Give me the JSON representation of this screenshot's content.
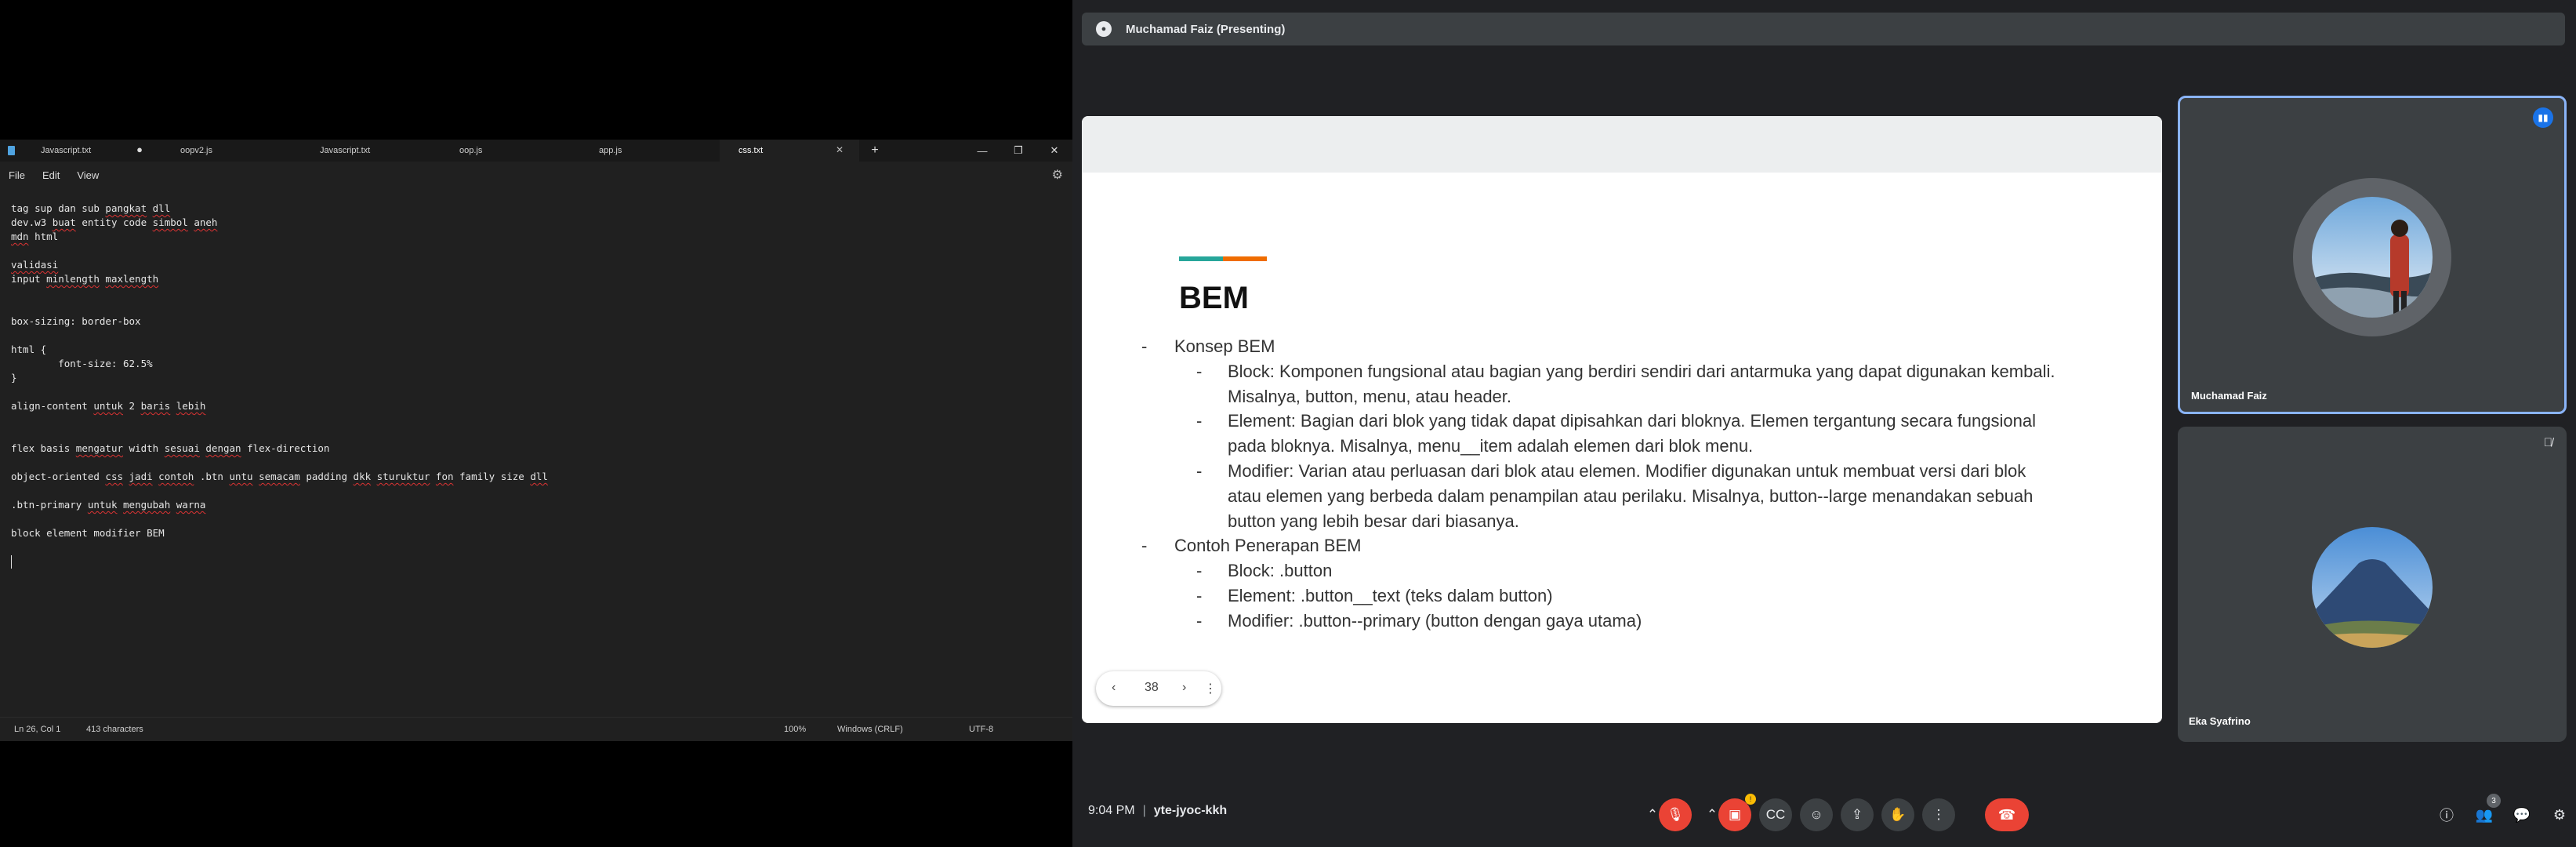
{
  "notepad": {
    "tabs": [
      {
        "label": "Javascript.txt"
      },
      {
        "label": "oopv2.js"
      },
      {
        "label": "Javascript.txt"
      },
      {
        "label": "oop.js"
      },
      {
        "label": "app.js"
      },
      {
        "label": "css.txt"
      }
    ],
    "menu": {
      "file": "File",
      "edit": "Edit",
      "view": "View"
    },
    "lines": {
      "l1a": "tag sup dan sub ",
      "l1b": "pangkat",
      "l1c": " ",
      "l1d": "dll",
      "l2a": "dev.w3 ",
      "l2b": "buat",
      "l2c": " entity code ",
      "l2d": "simbol",
      "l2e": " ",
      "l2f": "aneh",
      "l3a": "mdn",
      "l3b": " html",
      "l5a": "validasi",
      "l6a": "input ",
      "l6b": "minlength",
      "l6c": " ",
      "l6d": "maxlength",
      "l9": "box-sizing: border-box",
      "l11": "html {",
      "l12": "        font-size: 62.5%",
      "l13": "}",
      "l15a": "align-content ",
      "l15b": "untuk",
      "l15c": " 2 ",
      "l15d": "baris",
      "l15e": " ",
      "l15f": "lebih",
      "l18a": "flex basis ",
      "l18b": "mengatur",
      "l18c": " width ",
      "l18d": "sesuai",
      "l18e": " ",
      "l18f": "dengan",
      "l18g": " flex-direction",
      "l20a": "object-oriented ",
      "l20b": "css",
      "l20c": " ",
      "l20d": "jadi",
      "l20e": " ",
      "l20f": "contoh",
      "l20g": " .btn ",
      "l20h": "untu",
      "l20i": " ",
      "l20j": "semacam",
      "l20k": " padding ",
      "l20l": "dkk",
      "l20m": " ",
      "l20n": "sturuktur",
      "l20o": " ",
      "l20p": "fon",
      "l20q": " family size ",
      "l20r": "dll",
      "l22a": ".btn-primary ",
      "l22b": "untuk",
      "l22c": " ",
      "l22d": "mengubah",
      "l22e": " ",
      "l22f": "warna",
      "l24": "block element modifier BEM"
    },
    "status": {
      "position": "Ln 26, Col 1",
      "chars": "413 characters",
      "zoom": "100%",
      "eol": "Windows (CRLF)",
      "encoding": "UTF-8"
    }
  },
  "meet": {
    "presenter": "Muchamad Faiz (Presenting)",
    "slide": {
      "title": "BEM",
      "deco_colors": [
        "#26a69a",
        "#ef6c00"
      ],
      "b1": "Konsep BEM",
      "b1_1a": "Block: Komponen fungsional atau bagian yang berdiri sendiri dari antarmuka yang dapat digunakan kembali.",
      "b1_1b": "Misalnya, button, menu, atau header.",
      "b1_2a": "Element: Bagian dari blok yang tidak dapat dipisahkan dari bloknya. Elemen tergantung secara fungsional",
      "b1_2b": "pada bloknya. Misalnya, menu__item adalah elemen dari blok menu.",
      "b1_3a": "Modifier: Varian atau perluasan dari blok atau elemen. Modifier digunakan untuk membuat versi dari blok",
      "b1_3b": "atau elemen yang berbeda dalam penampilan atau perilaku. Misalnya, button--large menandakan sebuah",
      "b1_3c": "button yang lebih besar dari biasanya.",
      "b2": "Contoh Penerapan BEM",
      "b2_1": "Block: .button",
      "b2_2": "Element: .button__text (teks dalam button)",
      "b2_3": "Modifier: .button--primary (button dengan gaya utama)",
      "dash": "-",
      "page": "38"
    },
    "participants": [
      {
        "name": "Muchamad Faiz"
      },
      {
        "name": "Eka Syafrino"
      }
    ],
    "time": "9:04 PM",
    "separator": "|",
    "meeting_code": "yte-jyoc-kkh",
    "people_count": "3",
    "colors": {
      "accent": "#8ab4f8",
      "danger": "#ea4335",
      "panel": "#3c4043",
      "bg": "#202124"
    }
  }
}
